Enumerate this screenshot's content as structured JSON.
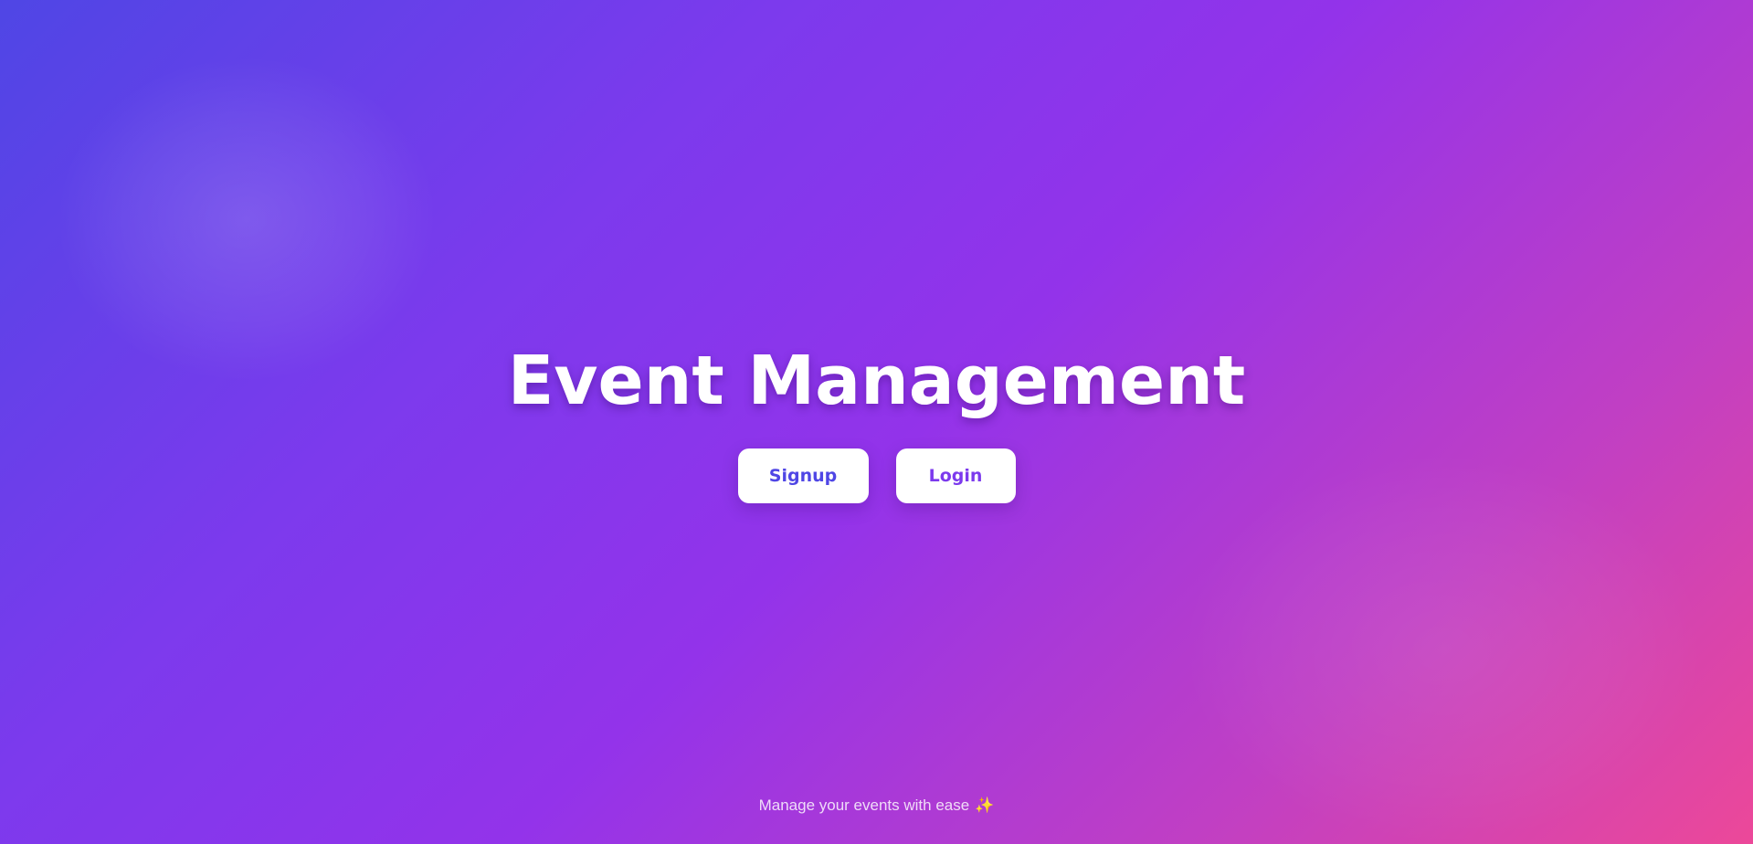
{
  "hero": {
    "title": "Event Management"
  },
  "actions": {
    "signup_label": "Signup",
    "login_label": "Login"
  },
  "footer": {
    "tagline": "Manage your events with ease",
    "icon": "sparkles-icon"
  },
  "colors": {
    "gradient_start": "#4f46e5",
    "gradient_mid": "#9333ea",
    "gradient_end": "#ec4899",
    "signup_text": "#4f46e5",
    "login_text": "#7c3aed"
  }
}
